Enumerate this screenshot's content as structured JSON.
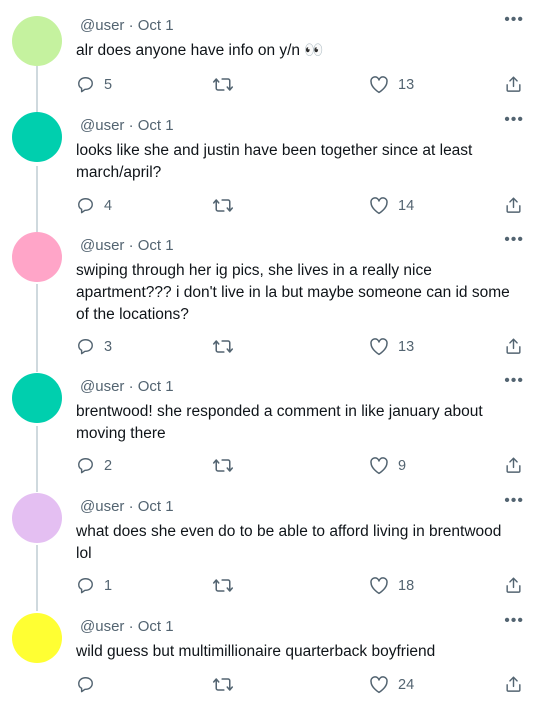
{
  "tweets": [
    {
      "handle": "@user",
      "sep": "·",
      "date": "Oct 1",
      "avatar_color": "#c5f29f",
      "text": "alr does anyone have info on y/n 👀",
      "replies": "5",
      "retweets": "",
      "likes": "13"
    },
    {
      "handle": "@user",
      "sep": "·",
      "date": "Oct 1",
      "avatar_color": "#00cfae",
      "text": "looks like she and justin have been together since at least march/april?",
      "replies": "4",
      "retweets": "",
      "likes": "14"
    },
    {
      "handle": "@user",
      "sep": "·",
      "date": "Oct 1",
      "avatar_color": "#ffa5c8",
      "text": "swiping through her ig pics, she lives in a really nice apartment??? i don't live in la but maybe someone can id some of the locations?",
      "replies": "3",
      "retweets": "",
      "likes": "13"
    },
    {
      "handle": "@user",
      "sep": "·",
      "date": "Oct 1",
      "avatar_color": "#00cfae",
      "text": "brentwood! she responded a comment in like january about moving there",
      "replies": "2",
      "retweets": "",
      "likes": "9"
    },
    {
      "handle": "@user",
      "sep": "·",
      "date": "Oct 1",
      "avatar_color": "#e4bff2",
      "text": "what does she even do to be able to afford living in brentwood lol",
      "replies": "1",
      "retweets": "",
      "likes": "18"
    },
    {
      "handle": "@user",
      "sep": "·",
      "date": "Oct 1",
      "avatar_color": "#ffff33",
      "text": "wild guess but multimillionaire quarterback boyfriend",
      "replies": "",
      "retweets": "",
      "likes": "24"
    }
  ],
  "icons": {
    "more": "more-horizontal-icon",
    "reply": "reply-icon",
    "retweet": "retweet-icon",
    "like": "heart-icon",
    "share": "share-icon"
  },
  "colors": {
    "text": "#0f1419",
    "muted": "#536471",
    "thread_line": "#cfd9de"
  }
}
